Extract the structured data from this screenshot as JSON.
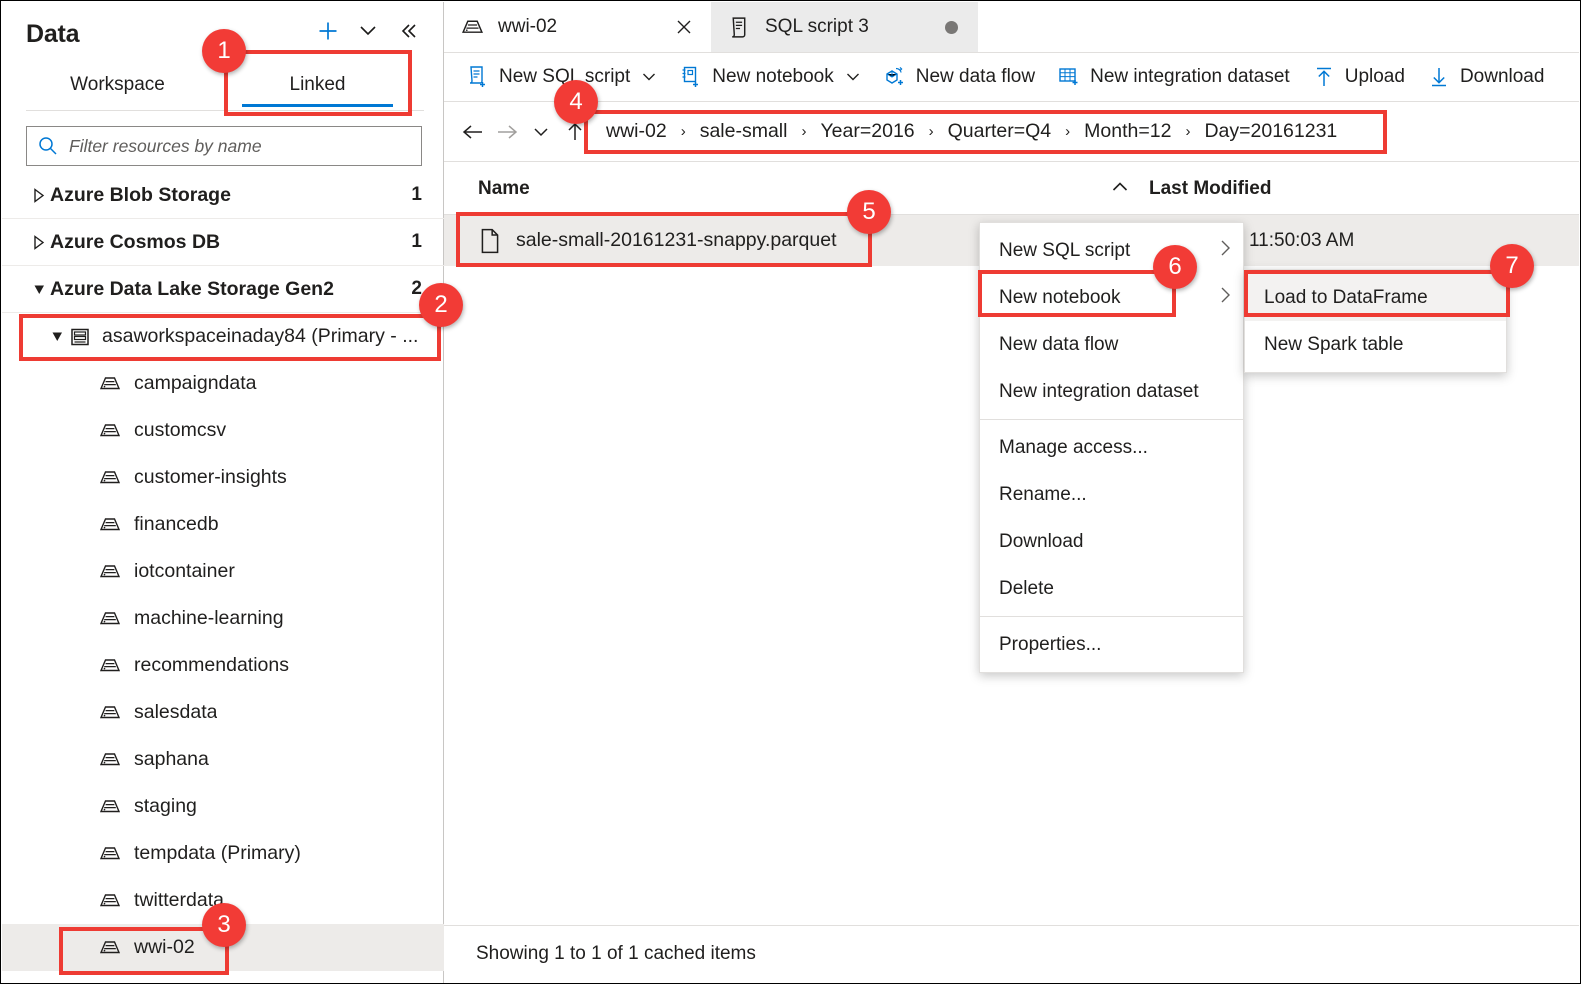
{
  "left_panel": {
    "title": "Data",
    "actions": [
      {
        "name": "add-icon",
        "glyph": "+"
      },
      {
        "name": "chevron-double-down-icon",
        "glyph": "ˇ"
      },
      {
        "name": "collapse-panel-icon",
        "glyph": "«"
      }
    ],
    "tabs": [
      {
        "label": "Workspace",
        "selected": false
      },
      {
        "label": "Linked",
        "selected": true
      }
    ],
    "filter": {
      "placeholder": "Filter resources by name",
      "value": ""
    },
    "tree": [
      {
        "label": "Azure Blob Storage",
        "count": "1",
        "level": 1,
        "expanded": false
      },
      {
        "label": "Azure Cosmos DB",
        "count": "1",
        "level": 1,
        "expanded": false
      },
      {
        "label": "Azure Data Lake Storage Gen2",
        "count": "2",
        "level": 1,
        "expanded": true
      },
      {
        "label": "asaworkspaceinaday84 (Primary - ...",
        "count": "",
        "level": 2,
        "expanded": true
      },
      {
        "label": "campaigndata",
        "count": "",
        "level": 3
      },
      {
        "label": "customcsv",
        "count": "",
        "level": 3
      },
      {
        "label": "customer-insights",
        "count": "",
        "level": 3
      },
      {
        "label": "financedb",
        "count": "",
        "level": 3
      },
      {
        "label": "iotcontainer",
        "count": "",
        "level": 3
      },
      {
        "label": "machine-learning",
        "count": "",
        "level": 3
      },
      {
        "label": "recommendations",
        "count": "",
        "level": 3
      },
      {
        "label": "salesdata",
        "count": "",
        "level": 3
      },
      {
        "label": "saphana",
        "count": "",
        "level": 3
      },
      {
        "label": "staging",
        "count": "",
        "level": 3
      },
      {
        "label": "tempdata (Primary)",
        "count": "",
        "level": 3
      },
      {
        "label": "twitterdata",
        "count": "",
        "level": 3
      },
      {
        "label": "wwi-02",
        "count": "",
        "level": 3,
        "selected": true
      }
    ]
  },
  "doc_tabs": [
    {
      "label": "wwi-02",
      "icon": "container-icon",
      "active": true,
      "close_glyph": "×"
    },
    {
      "label": "SQL script 3",
      "icon": "sql-script-icon",
      "active": false,
      "dirty": true
    }
  ],
  "command_bar": [
    {
      "label": "New SQL script",
      "icon": "new-sql-script-icon",
      "caret": true
    },
    {
      "label": "New notebook",
      "icon": "new-notebook-icon",
      "caret": true
    },
    {
      "label": "New data flow",
      "icon": "new-data-flow-icon",
      "caret": false
    },
    {
      "label": "New integration dataset",
      "icon": "new-integration-dataset-icon",
      "caret": false
    },
    {
      "label": "Upload",
      "icon": "upload-icon",
      "caret": false
    },
    {
      "label": "Download",
      "icon": "download-icon",
      "caret": false
    }
  ],
  "nav": {
    "back": "←",
    "forward": "→",
    "history": "∨",
    "up": "↑"
  },
  "breadcrumb": {
    "separator": "›",
    "items": [
      "wwi-02",
      "sale-small",
      "Year=2016",
      "Quarter=Q4",
      "Month=12",
      "Day=20161231"
    ]
  },
  "file_list": {
    "columns": {
      "name": "Name",
      "last_modified": "Last Modified",
      "sort_caret": "⌃"
    },
    "rows": [
      {
        "name": "sale-small-20161231-snappy.parquet",
        "last_modified": "11:50:03 AM",
        "selected": true
      }
    ]
  },
  "footer": {
    "status": "Showing 1 to 1 of 1 cached items"
  },
  "context_menu": {
    "items": [
      {
        "label": "New SQL script",
        "submenu": true,
        "highlighted": false
      },
      {
        "label": "New notebook",
        "submenu": true,
        "highlighted": false
      },
      {
        "label": "New data flow",
        "submenu": false,
        "highlighted": false
      },
      {
        "label": "New integration dataset",
        "submenu": false,
        "highlighted": false
      },
      {
        "separator": true
      },
      {
        "label": "Manage access...",
        "submenu": false,
        "highlighted": false
      },
      {
        "label": "Rename...",
        "submenu": false,
        "highlighted": false
      },
      {
        "label": "Download",
        "submenu": false,
        "highlighted": false
      },
      {
        "label": "Delete",
        "submenu": false,
        "highlighted": false
      },
      {
        "separator": true
      },
      {
        "label": "Properties...",
        "submenu": false,
        "highlighted": false
      }
    ],
    "submenu_arrow": "›"
  },
  "context_submenu": {
    "items": [
      {
        "label": "Load to DataFrame",
        "highlighted": true
      },
      {
        "label": "New Spark table",
        "highlighted": false
      }
    ]
  },
  "annotations": {
    "accent_color": "#ee3b33",
    "badges": [
      {
        "number": "1"
      },
      {
        "number": "2"
      },
      {
        "number": "3"
      },
      {
        "number": "4"
      },
      {
        "number": "5"
      },
      {
        "number": "6"
      },
      {
        "number": "7"
      }
    ]
  }
}
